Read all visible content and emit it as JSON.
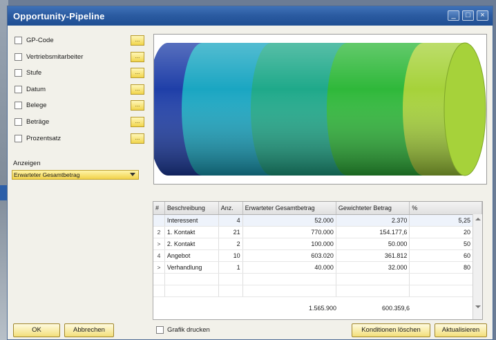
{
  "window": {
    "title": "Opportunity-Pipeline"
  },
  "criteria": [
    {
      "label": "GP-Code",
      "button": "..."
    },
    {
      "label": "Vertriebsmitarbeiter",
      "button": "..."
    },
    {
      "label": "Stufe",
      "button": "..."
    },
    {
      "label": "Datum",
      "button": "..."
    },
    {
      "label": "Belege",
      "button": "..."
    },
    {
      "label": "Beträge",
      "button": "..."
    },
    {
      "label": "Prozentsatz",
      "button": "..."
    }
  ],
  "anzeigen": {
    "label": "Anzeigen",
    "value": "Erwarteter Gesamtbetrag"
  },
  "pipeline_graph": {
    "type": "cylinder",
    "segments": [
      {
        "stage": "Interessent",
        "color": "#1f3fa8"
      },
      {
        "stage": "1. Kontakt",
        "color": "#1aa6c2"
      },
      {
        "stage": "2. Kontakt",
        "color": "#1fa98a"
      },
      {
        "stage": "Angebot",
        "color": "#2fb83a"
      },
      {
        "stage": "Verhandlung",
        "color": "#a6d23a"
      }
    ]
  },
  "table": {
    "headers": [
      "#",
      "Beschreibung",
      "Anz.",
      "Erwarteter Gesamtbetrag",
      "Gewichteter Betrag",
      "%"
    ],
    "rows": [
      {
        "rn": "",
        "desc": "Interessent",
        "anz": "4",
        "exp": "52.000",
        "wgt": "2.370",
        "pct": "5,25"
      },
      {
        "rn": "2",
        "desc": "1. Kontakt",
        "anz": "21",
        "exp": "770.000",
        "wgt": "154.177,6",
        "pct": "20"
      },
      {
        "rn": ">",
        "desc": "2. Kontakt",
        "anz": "2",
        "exp": "100.000",
        "wgt": "50.000",
        "pct": "50"
      },
      {
        "rn": "4",
        "desc": "Angebot",
        "anz": "10",
        "exp": "603.020",
        "wgt": "361.812",
        "pct": "60"
      },
      {
        "rn": ">",
        "desc": "Verhandlung",
        "anz": "1",
        "exp": "40.000",
        "wgt": "32.000",
        "pct": "80"
      }
    ],
    "totals": {
      "exp": "1.565.900",
      "wgt": "600.359,6"
    }
  },
  "buttons": {
    "ok": "OK",
    "cancel": "Abbrechen",
    "clear": "Konditionen löschen",
    "refresh": "Aktualisieren"
  },
  "grafik_label": "Grafik drucken"
}
